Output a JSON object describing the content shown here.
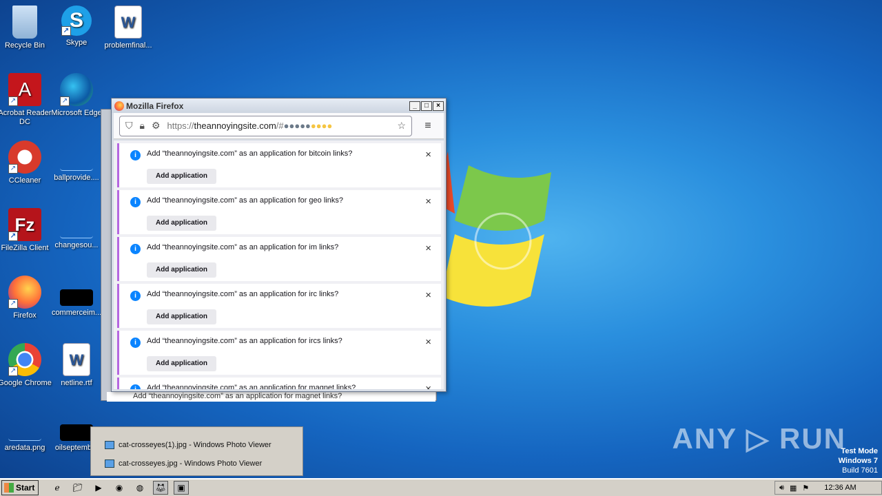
{
  "desktop_icons": [
    {
      "label": "Recycle Bin",
      "icon": "recycle-bin-icon"
    },
    {
      "label": "Skype",
      "icon": "skype-icon"
    },
    {
      "label": "problemfinal...",
      "icon": "word-doc-icon"
    },
    {
      "label": "Acrobat Reader DC",
      "icon": "acrobat-icon"
    },
    {
      "label": "Microsoft Edge",
      "icon": "edge-icon"
    },
    {
      "label": "CCleaner",
      "icon": "ccleaner-icon"
    },
    {
      "label": "ballprovide....",
      "icon": "file-icon"
    },
    {
      "label": "FileZilla Client",
      "icon": "filezilla-icon"
    },
    {
      "label": "changesou...",
      "icon": "file-icon"
    },
    {
      "label": "Firefox",
      "icon": "firefox-icon"
    },
    {
      "label": "commerceim...",
      "icon": "image-icon"
    },
    {
      "label": "Google Chrome",
      "icon": "chrome-icon"
    },
    {
      "label": "netline.rtf",
      "icon": "word-doc-icon"
    },
    {
      "label": "aredata.png",
      "icon": "image-icon"
    },
    {
      "label": "oilseptemb...",
      "icon": "image-icon"
    }
  ],
  "firefox": {
    "title": "Mozilla Firefox",
    "url_prefix": "https://",
    "url_host": "theannoyingsite.com",
    "url_rest": "/#",
    "notifications": [
      {
        "message": "Add “theannoyingsite.com” as an application for bitcoin links?",
        "button": "Add application"
      },
      {
        "message": "Add “theannoyingsite.com” as an application for geo links?",
        "button": "Add application"
      },
      {
        "message": "Add “theannoyingsite.com” as an application for im links?",
        "button": "Add application"
      },
      {
        "message": "Add “theannoyingsite.com” as an application for irc links?",
        "button": "Add application"
      },
      {
        "message": "Add “theannoyingsite.com” as an application for ircs links?",
        "button": "Add application"
      },
      {
        "message": "Add “theannoyingsite.com” as an application for magnet links?",
        "button": ""
      }
    ],
    "back_window_note": "Add “theannoyingsite.com” as an application for magnet links?"
  },
  "thumbnail_popup": [
    "cat-crosseyes(1).jpg - Windows Photo Viewer",
    "cat-crosseyes.jpg - Windows Photo Viewer"
  ],
  "taskbar": {
    "start_label": "Start",
    "clock": "12:36 AM"
  },
  "watermark": "ANY ▷ RUN",
  "test_mode": {
    "line1": "Test Mode",
    "line2": "Windows 7",
    "line3": "Build 7601"
  }
}
